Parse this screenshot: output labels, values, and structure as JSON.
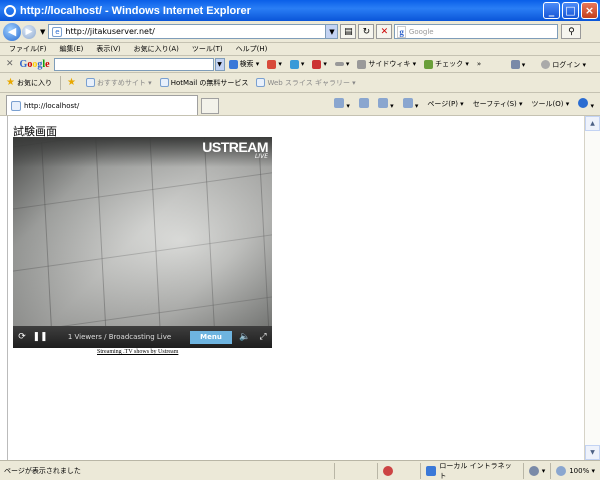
{
  "window": {
    "title": "http://localhost/ - Windows Internet Explorer"
  },
  "address": {
    "url": "http://jitakuserver.net/"
  },
  "search": {
    "placeholder": "Google"
  },
  "menu": [
    "ファイル(F)",
    "編集(E)",
    "表示(V)",
    "お気に入り(A)",
    "ツール(T)",
    "ヘルプ(H)"
  ],
  "google_toolbar": {
    "search_label": "検索",
    "sidewiki": "サイドウィキ",
    "check": "チェック",
    "more": "»",
    "login": "ログイン"
  },
  "favorites": {
    "label": "お気に入り",
    "items": [
      {
        "label": "おすすめサイト",
        "dim": true
      },
      {
        "label": "HotMail の無料サービス",
        "dim": false
      },
      {
        "label": "Web スライス ギャラリー",
        "dim": true
      }
    ]
  },
  "tab": {
    "label": "http://localhost/"
  },
  "command_bar": {
    "page": "ページ(P)",
    "safety": "セーフティ(S)",
    "tools": "ツール(O)",
    "help": "?"
  },
  "page": {
    "heading": "試験画面",
    "player": {
      "logo": "USTREAM",
      "live_label": "LIVE",
      "status": "1 Viewers / Broadcasting Live",
      "menu_label": "Menu"
    },
    "credit": "Streaming .TV shows by Ustream"
  },
  "statusbar": {
    "message": "ページが表示されました",
    "zone": "ローカル イントラネット",
    "zoom": "100%"
  },
  "colors": {
    "titlebar": "#0a5fe8",
    "chrome": "#ece9d8",
    "menu_button": "#6eb4e0"
  }
}
